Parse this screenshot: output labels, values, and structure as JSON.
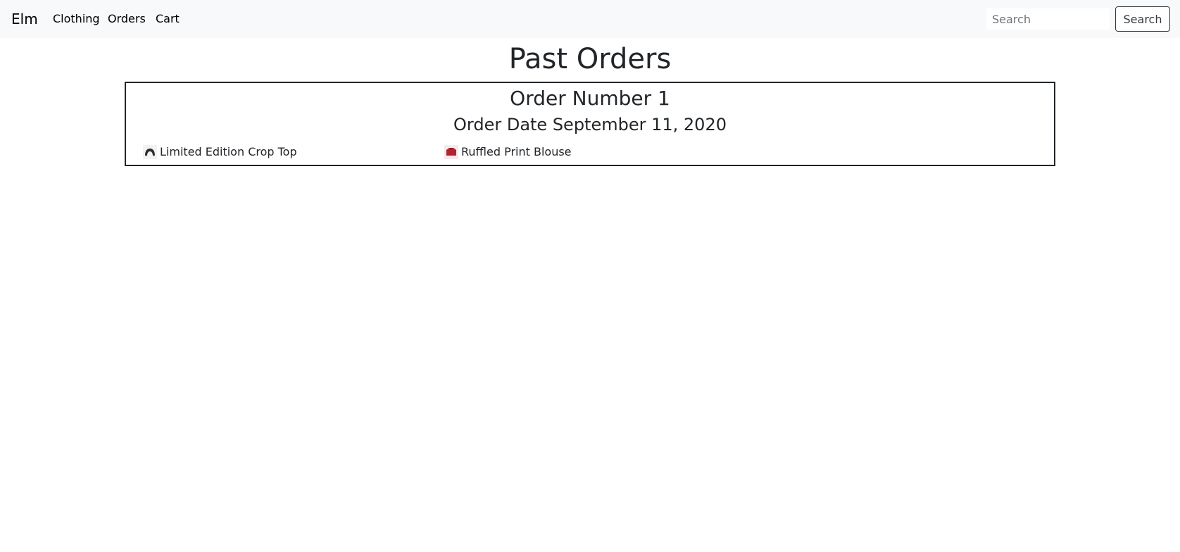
{
  "navbar": {
    "brand": "Elm",
    "links": [
      {
        "label": "Clothing"
      },
      {
        "label": "Orders"
      },
      {
        "label": "Cart"
      }
    ],
    "search": {
      "placeholder": "Search",
      "value": "",
      "button_label": "Search"
    }
  },
  "page": {
    "title": "Past Orders"
  },
  "orders": [
    {
      "number_label": "Order Number 1",
      "date_label": "Order Date September 11, 2020",
      "items": [
        {
          "name": "Limited Edition Crop Top",
          "icon": "crop-top-thumbnail-icon",
          "color": "#2b2b2e"
        },
        {
          "name": "Ruffled Print Blouse",
          "icon": "blouse-thumbnail-icon",
          "color": "#b0232f"
        }
      ]
    }
  ]
}
